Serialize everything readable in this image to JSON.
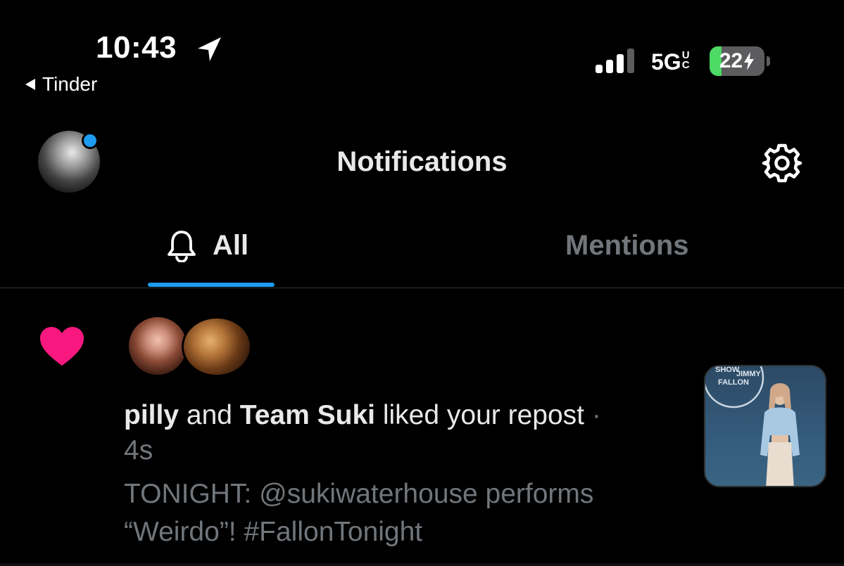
{
  "status_bar": {
    "time": "10:43",
    "back_app": "Tinder",
    "network_main": "5G",
    "network_sup": "U",
    "network_sub": "C",
    "battery_level": "22",
    "battery_fraction": 0.22,
    "battery_charging": true
  },
  "header": {
    "title": "Notifications",
    "settings_icon": "gear-icon",
    "avatar_has_badge": true
  },
  "tabs": [
    {
      "label": "All",
      "icon": "bell-icon",
      "active": true
    },
    {
      "label": "Mentions",
      "active": false
    }
  ],
  "notification": {
    "type_icon": "heart-icon",
    "user1": "pilly",
    "connector": "and",
    "user2": "Team Suki",
    "action": "liked your repost",
    "separator": "·",
    "time": "4s",
    "tweet_text": "TONIGHT: @sukiwaterhouse performs “Weirdo”! #FallonTonight",
    "thumbnail_logo": [
      "SHOW",
      "JIMMY",
      "FALLON"
    ]
  },
  "colors": {
    "background": "#000000",
    "text_primary": "#e7e9ea",
    "text_muted": "#71767b",
    "accent_blue": "#1d9bf0",
    "heart_pink": "#f91880",
    "battery_green": "#4cd964",
    "divider": "#2f3336"
  }
}
